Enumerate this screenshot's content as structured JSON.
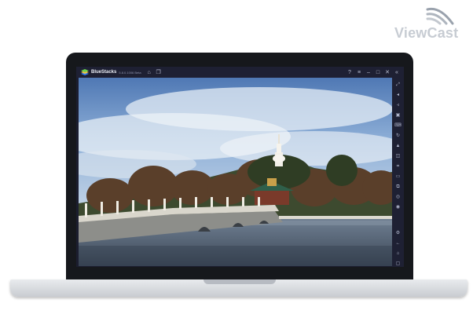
{
  "watermark": {
    "brand": "ViewCast"
  },
  "emulator": {
    "app_name": "BlueStacks",
    "version_text": "5.8.0.1006 Beta"
  },
  "titlebar_icons": {
    "left": [
      "home-icon",
      "multi-instance-icon"
    ],
    "right": [
      "help-icon",
      "menu-icon",
      "minimize-icon",
      "maximize-icon",
      "close-icon",
      "collapse-sidebar-icon"
    ]
  },
  "right_toolbar_icons": [
    "fullscreen-icon",
    "volume-up-icon",
    "volume-down-icon",
    "screen-record-icon",
    "keyboard-icon",
    "rotate-icon",
    "shake-icon",
    "screenshot-icon",
    "macro-icon",
    "folder-icon",
    "copy-icon",
    "eco-mode-icon",
    "location-icon",
    "settings-icon",
    "back-icon",
    "home-icon",
    "recent-apps-icon"
  ],
  "screen_content": "landscape-photo"
}
